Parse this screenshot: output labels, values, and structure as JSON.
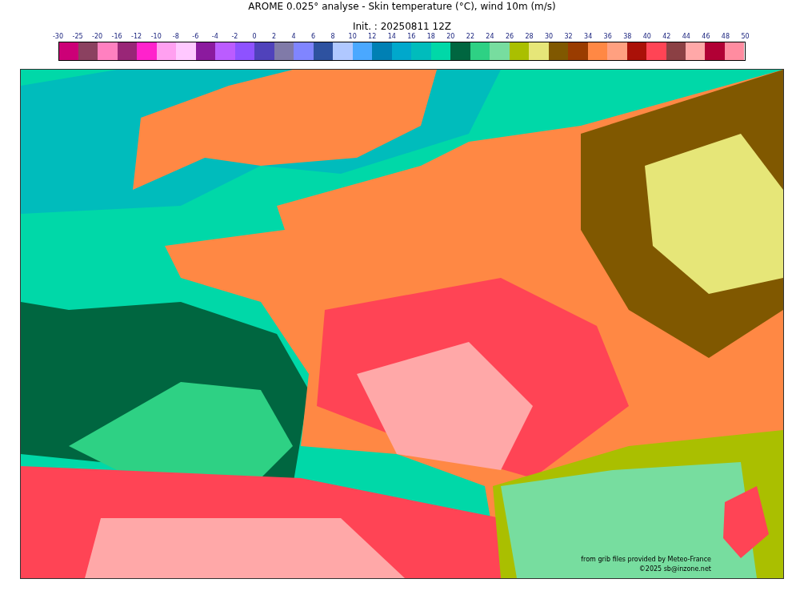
{
  "title": "AROME 0.025° analyse - Skin temperature (°C), wind 10m (m/s)",
  "subtitle": "Init. : 20250811 12Z",
  "colorbar": {
    "labels": [
      "-30",
      "-25",
      "-20",
      "-16",
      "-12",
      "-10",
      "-8",
      "-6",
      "-4",
      "-2",
      "0",
      "2",
      "4",
      "6",
      "8",
      "10",
      "12",
      "14",
      "16",
      "18",
      "20",
      "22",
      "24",
      "26",
      "28",
      "30",
      "32",
      "34",
      "36",
      "38",
      "40",
      "42",
      "44",
      "46",
      "48",
      "50"
    ],
    "swatches": [
      {
        "color": "#cc0077"
      },
      {
        "color": "#8b4160"
      },
      {
        "color": "#ff80c0"
      },
      {
        "color": "#992677"
      },
      {
        "color": "#ff22cc"
      },
      {
        "color": "#ffa0f0"
      },
      {
        "color": "#ffc8ff"
      },
      {
        "color": "#8b1a9e"
      },
      {
        "color": "#bb5cff"
      },
      {
        "color": "#8e52ff"
      },
      {
        "color": "#5042bb"
      },
      {
        "color": "#807aa8"
      },
      {
        "color": "#8085ff"
      },
      {
        "color": "#2e52a0"
      },
      {
        "color": "#b0c8ff"
      },
      {
        "color": "#4aa8ff"
      },
      {
        "color": "#0080b4"
      },
      {
        "color": "#00a8cc"
      },
      {
        "color": "#00bcbc"
      },
      {
        "color": "#00d8a8"
      },
      {
        "color": "#006640"
      },
      {
        "color": "#2ed184"
      },
      {
        "color": "#77dd9f"
      },
      {
        "color": "#aabf00"
      },
      {
        "color": "#e6e678"
      },
      {
        "color": "#805800"
      },
      {
        "color": "#9a3c00"
      },
      {
        "color": "#ff8844"
      },
      {
        "color": "#ffa080"
      },
      {
        "color": "#aa1108"
      },
      {
        "color": "#ff4455"
      },
      {
        "color": "#8b4044"
      },
      {
        "color": "#ffa8a8"
      },
      {
        "color": "#b10035"
      },
      {
        "color": "#ff8ca0"
      }
    ]
  },
  "map": {
    "credits": [
      "from grib files provided by Meteo-France",
      "©2025 sb@inzone.net"
    ]
  }
}
